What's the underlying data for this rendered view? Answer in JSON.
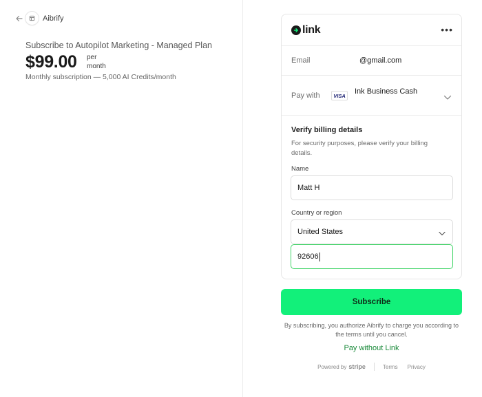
{
  "merchant": {
    "name": "Aibrify"
  },
  "summary": {
    "title": "Subscribe to Autopilot Marketing - Managed Plan",
    "price": "$99.00",
    "per_line1": "per",
    "per_line2": "month",
    "description": "Monthly subscription — 5,000 AI Credits/month"
  },
  "link": {
    "logo_text": "link",
    "more": "•••",
    "email_label": "Email",
    "email_value": "@gmail.com",
    "pay_with_label": "Pay with",
    "card_brand": "VISA",
    "card_name": "Ink Business Cash"
  },
  "verify": {
    "title": "Verify billing details",
    "text": "For security purposes, please verify your billing details.",
    "name_label": "Name",
    "name_value": "Matt H",
    "country_label": "Country or region",
    "country_value": "United States",
    "zip_value": "92606"
  },
  "actions": {
    "subscribe_label": "Subscribe",
    "terms_text": "By subscribing, you authorize Aibrify to charge you according to the terms until you cancel.",
    "pay_without_label": "Pay without Link"
  },
  "footer": {
    "powered_by": "Powered by",
    "stripe": "stripe",
    "terms": "Terms",
    "privacy": "Privacy"
  },
  "colors": {
    "accent_green": "#12f07a",
    "link_green_text": "#1a8a3a",
    "focus_border": "#3fd466"
  }
}
